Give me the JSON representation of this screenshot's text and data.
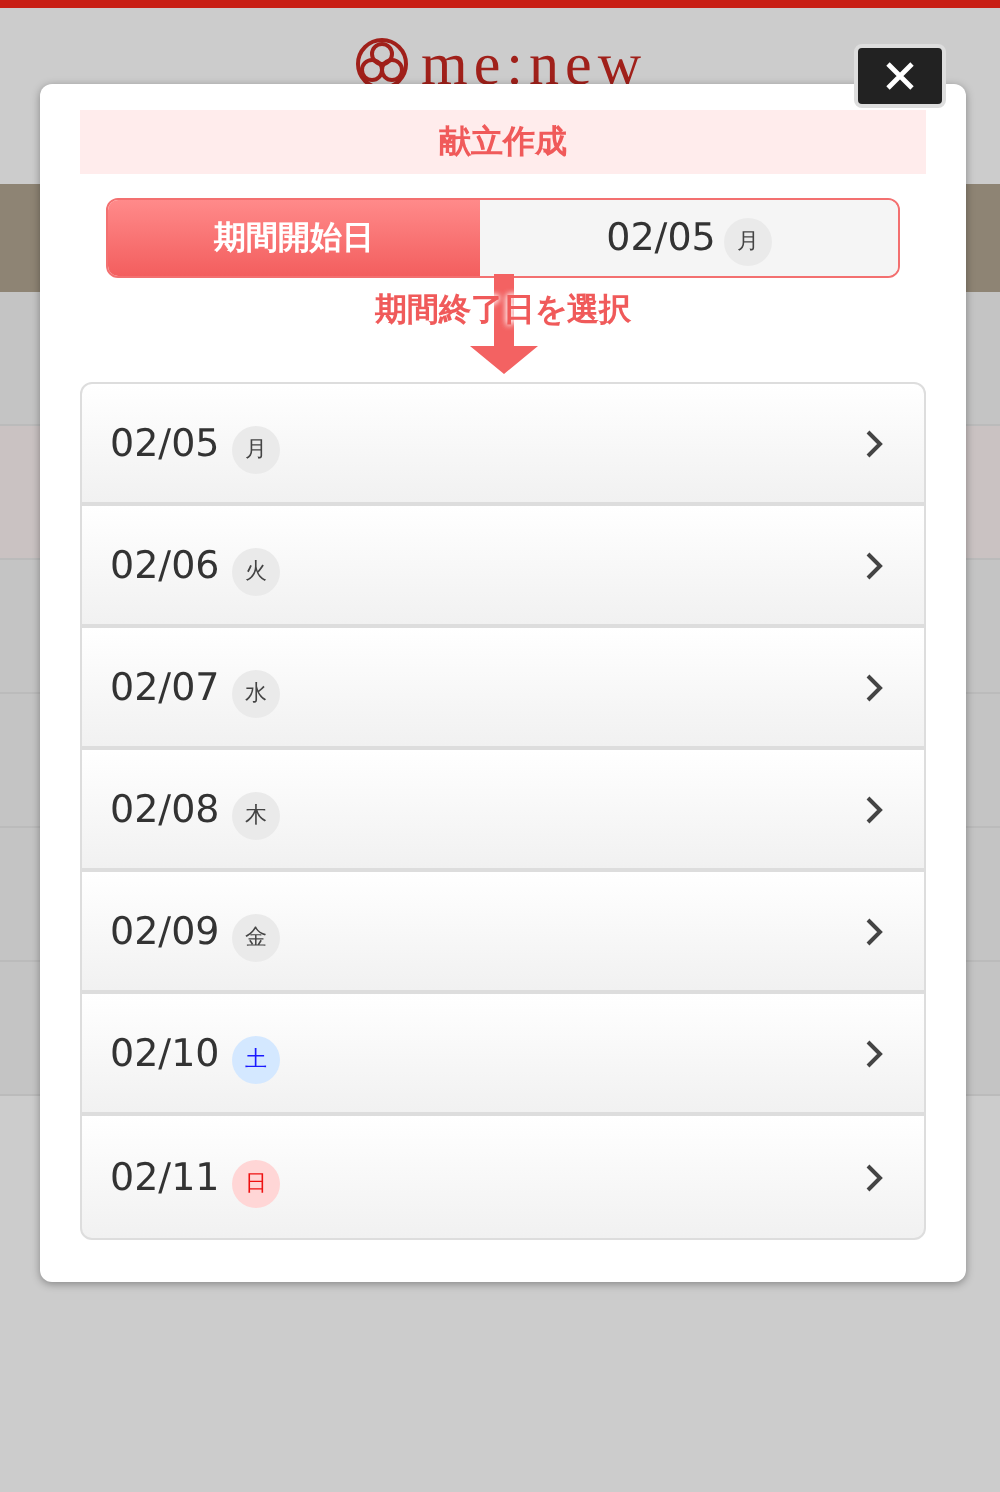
{
  "logo": "me:new",
  "dialog": {
    "title": "献立作成",
    "start": {
      "label": "期間開始日",
      "date": "02/05",
      "weekday": "月"
    },
    "instruction": "期間終了日を選択",
    "days": [
      {
        "date": "02/05",
        "weekday": "月",
        "kind": "weekday"
      },
      {
        "date": "02/06",
        "weekday": "火",
        "kind": "weekday"
      },
      {
        "date": "02/07",
        "weekday": "水",
        "kind": "weekday"
      },
      {
        "date": "02/08",
        "weekday": "木",
        "kind": "weekday"
      },
      {
        "date": "02/09",
        "weekday": "金",
        "kind": "weekday"
      },
      {
        "date": "02/10",
        "weekday": "土",
        "kind": "saturday"
      },
      {
        "date": "02/11",
        "weekday": "日",
        "kind": "sunday"
      }
    ]
  }
}
